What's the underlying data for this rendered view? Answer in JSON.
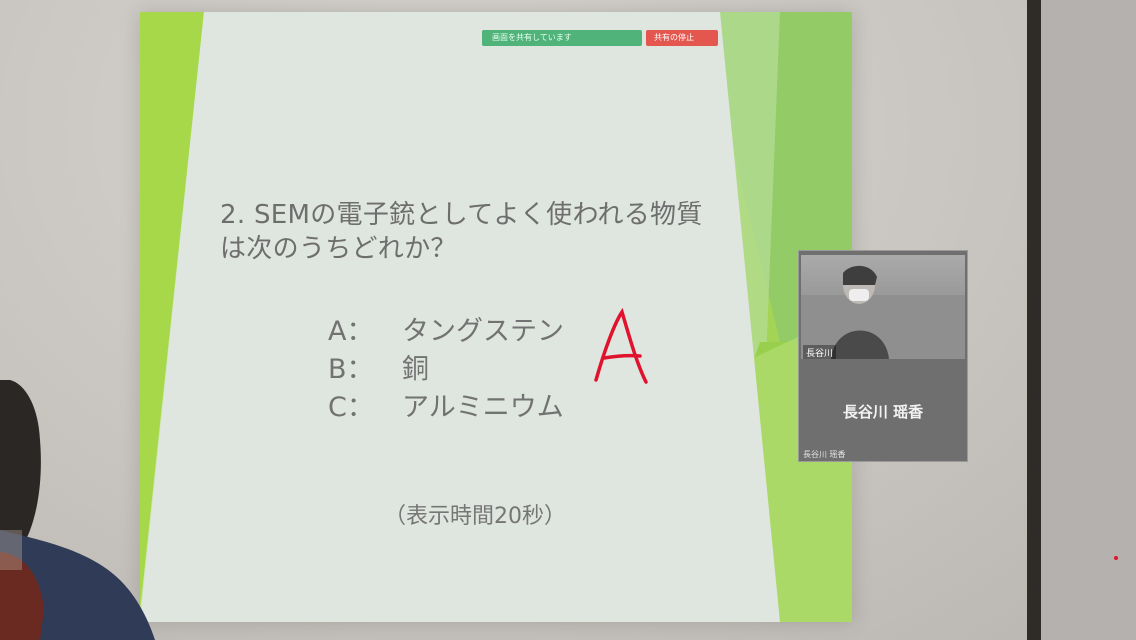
{
  "zoom_bar": {
    "share_label": "画面を共有しています",
    "stop_label": "共有の停止"
  },
  "slide": {
    "question_line1": "2. SEMの電子銃としてよく使われる物質",
    "question_line2": "は次のうちどれか？",
    "choices": [
      {
        "letter": "A：",
        "text": "タングステン"
      },
      {
        "letter": "B：",
        "text": "銅"
      },
      {
        "letter": "C：",
        "text": "アルミニウム"
      }
    ],
    "display_time": "（表示時間20秒）"
  },
  "annotation": {
    "text": "A",
    "color": "#e0122e"
  },
  "video_tile": {
    "tag": "長谷川",
    "name": "長谷川 瑶香",
    "subtitle": "長谷川 瑶香"
  },
  "colors": {
    "accent_green": "#a6d84a",
    "slide_bg": "#dfe5df",
    "text_gray": "#6e6e6e"
  }
}
